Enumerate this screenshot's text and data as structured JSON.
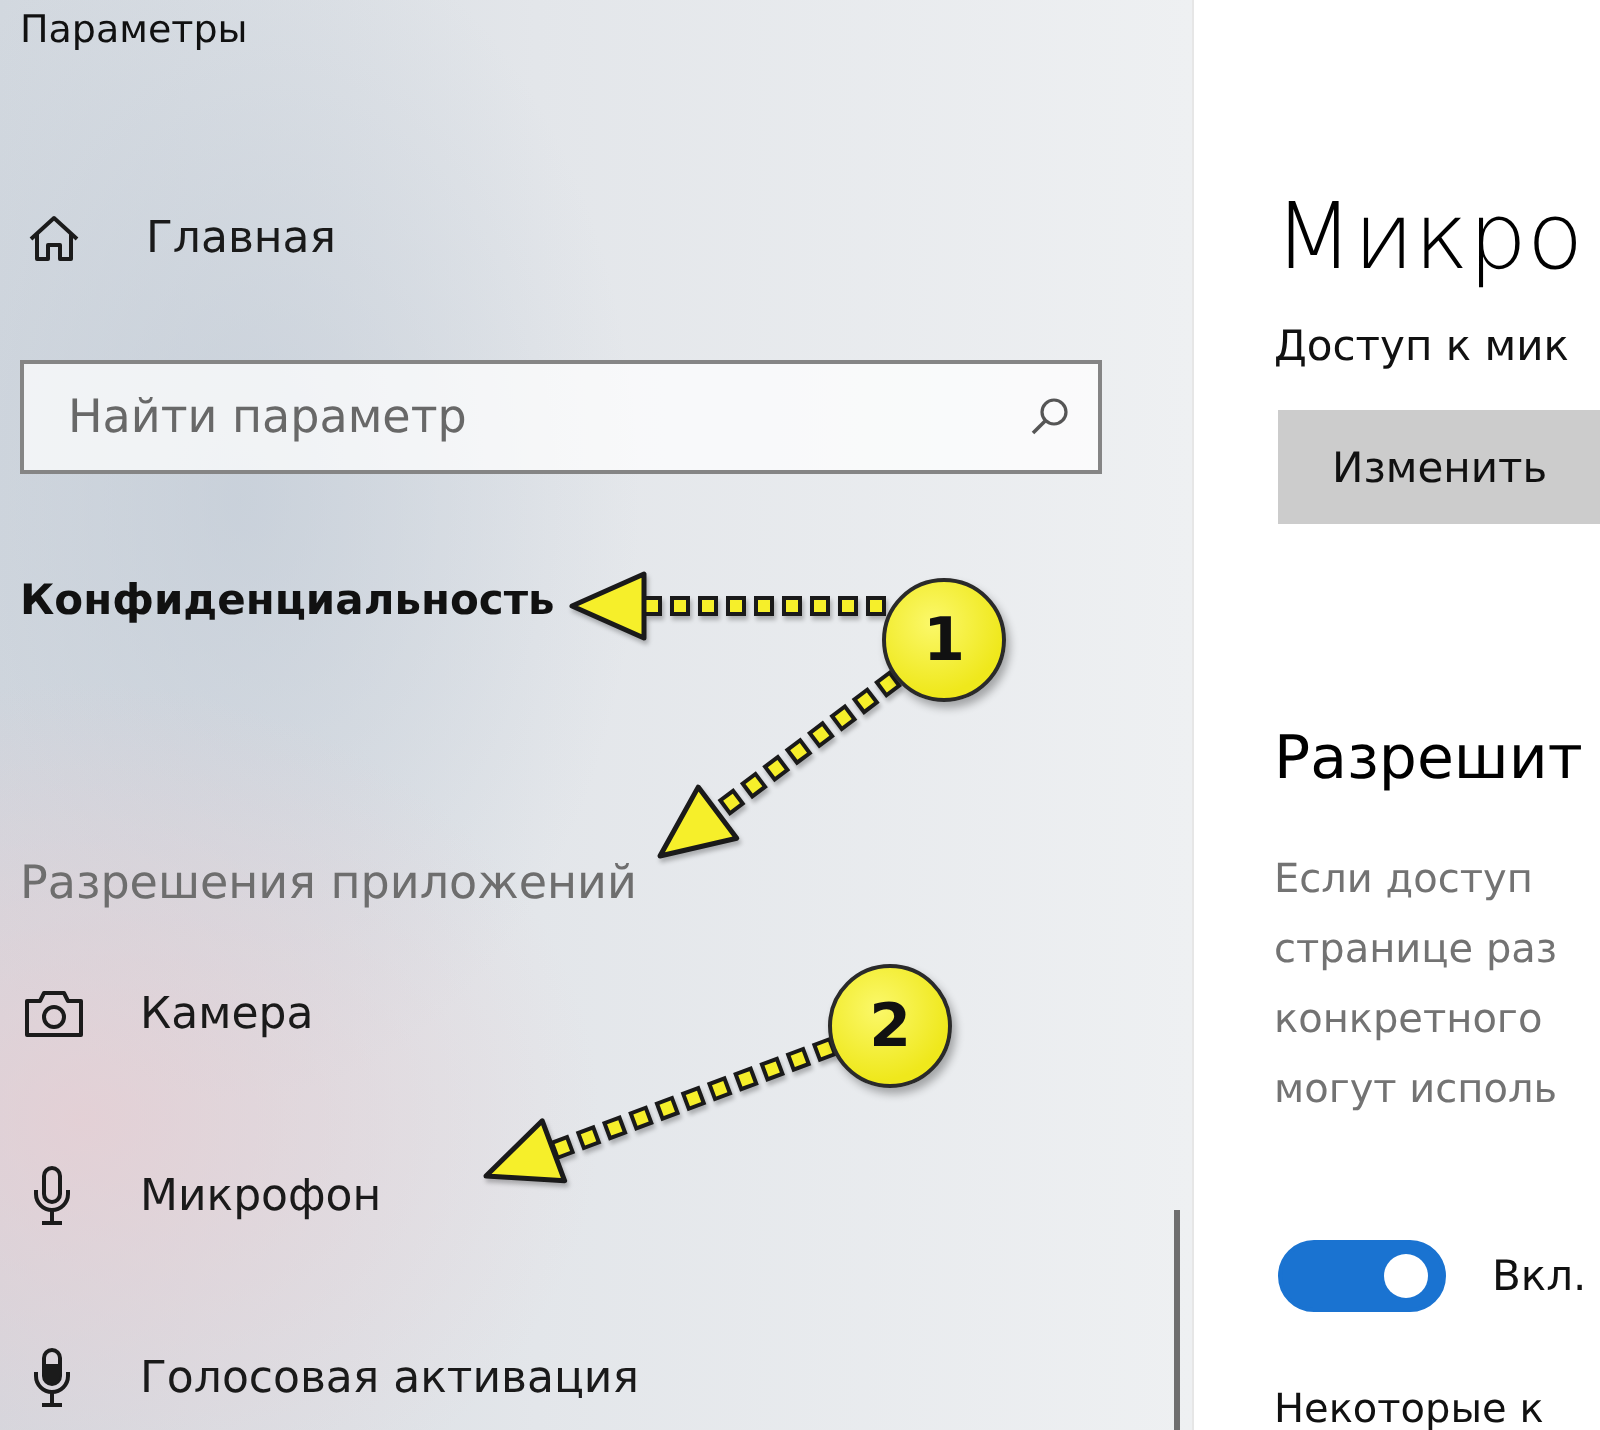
{
  "window": {
    "title": "Параметры"
  },
  "sidebar": {
    "home": {
      "label": "Главная"
    },
    "search": {
      "placeholder": "Найти параметр"
    },
    "section_title": "Конфиденциальность",
    "group_title": "Разрешения приложений",
    "items": [
      {
        "label": "Камера",
        "kind": "camera"
      },
      {
        "label": "Микрофон",
        "kind": "microphone"
      },
      {
        "label": "Голосовая активация",
        "kind": "voice"
      }
    ]
  },
  "callouts": [
    {
      "number": "1"
    },
    {
      "number": "2"
    }
  ],
  "page": {
    "title": "Микро",
    "subtitle": "Доступ к мик",
    "change_button": "Изменить",
    "section_title": "Разрешит",
    "description_lines": [
      "Если доступ",
      "странице раз",
      "конкретного",
      "могут исполь"
    ],
    "toggle": {
      "on": true,
      "label": "Вкл."
    },
    "footer_text": "Некоторые к"
  }
}
